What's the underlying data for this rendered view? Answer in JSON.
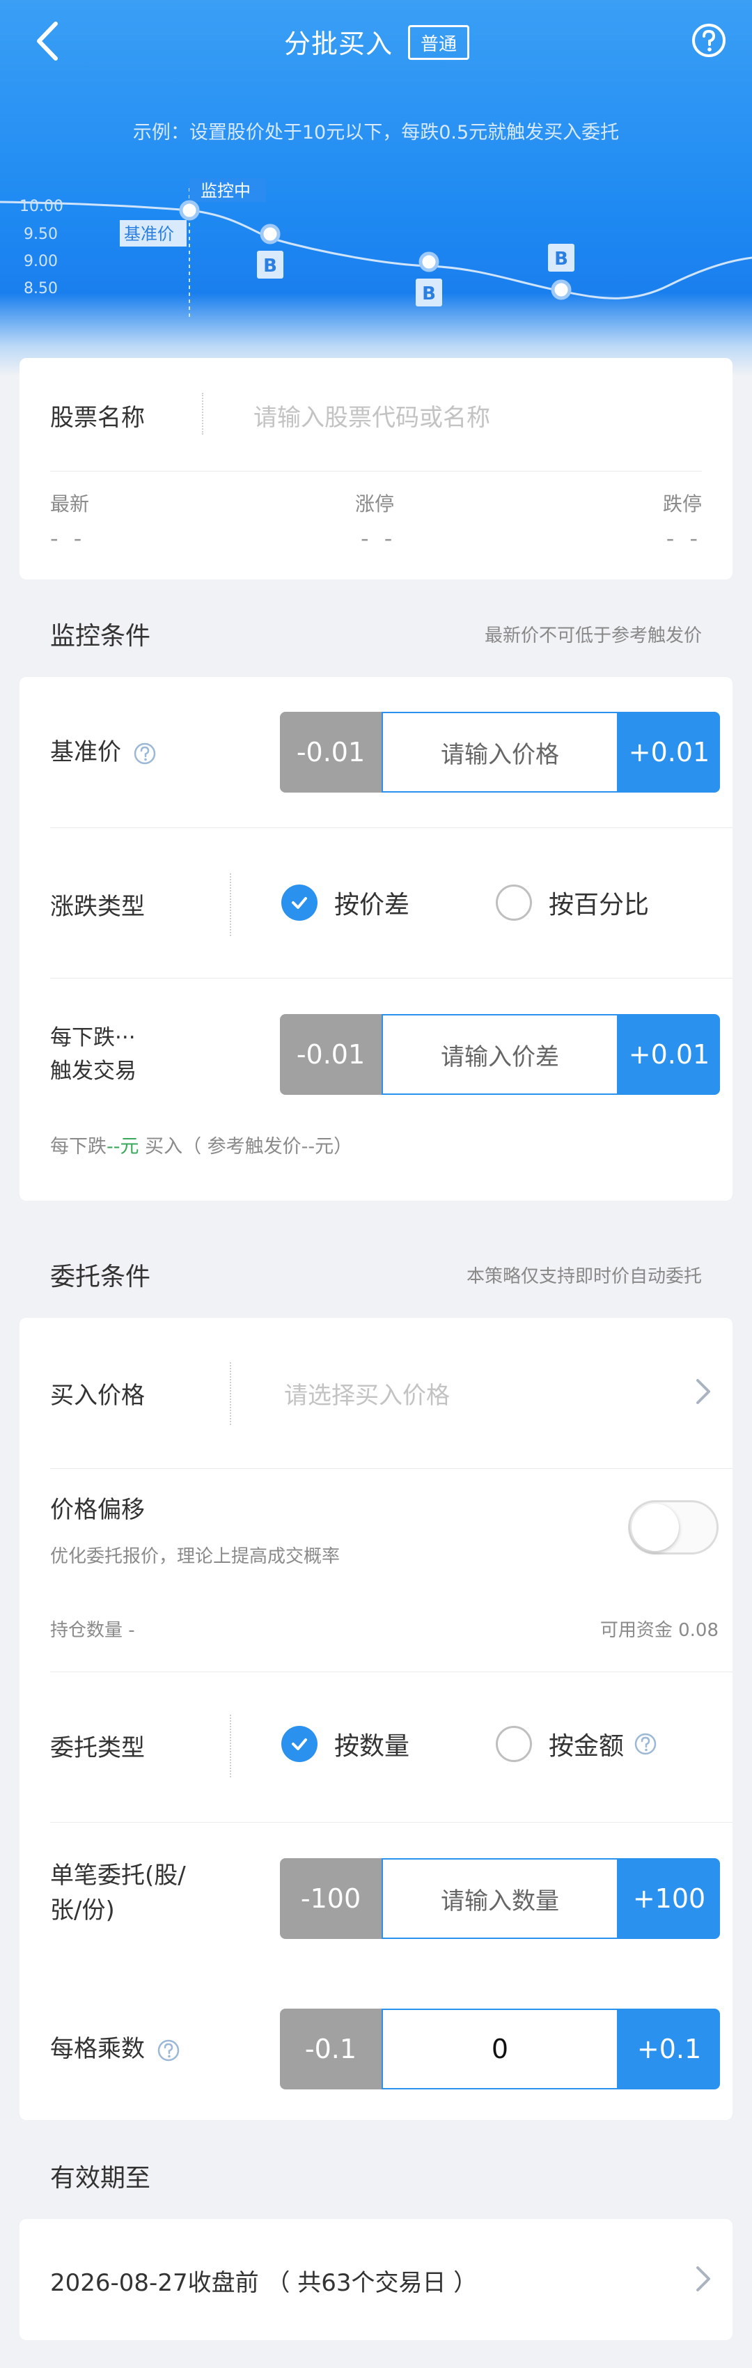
{
  "header": {
    "title": "分批买入",
    "badge": "普通",
    "example": "示例：设置股价处于10元以下，每跌0.5元就触发买入委托"
  },
  "chart_data": {
    "type": "line",
    "y_ticks": [
      "10.00",
      "9.50",
      "9.00",
      "8.50"
    ],
    "monitor_label": "监控中",
    "base_label": "基准价",
    "buy_marker": "B",
    "buy_points": [
      9.5,
      9.0,
      8.5
    ]
  },
  "stock": {
    "label": "股票名称",
    "placeholder": "请输入股票代码或名称",
    "latest_label": "最新",
    "latest_value": "- -",
    "limit_up_label": "涨停",
    "limit_up_value": "- -",
    "limit_down_label": "跌停",
    "limit_down_value": "- -"
  },
  "monitor": {
    "title": "监控条件",
    "note": "最新价不可低于参考触发价",
    "base_price": {
      "label": "基准价",
      "minus": "-0.01",
      "placeholder": "请输入价格",
      "plus": "+0.01"
    },
    "change_type": {
      "label": "涨跌类型",
      "option1": "按价差",
      "option2": "按百分比"
    },
    "drop": {
      "label_line1": "每下跌···",
      "label_line2": "触发交易",
      "minus": "-0.01",
      "placeholder": "请输入价差",
      "plus": "+0.01"
    },
    "hint_prefix": "每下跌",
    "hint_value": "--元",
    "hint_suffix": " 买入（ 参考触发价--元）"
  },
  "order": {
    "title": "委托条件",
    "note": "本策略仅支持即时价自动委托",
    "buy_price": {
      "label": "买入价格",
      "placeholder": "请选择买入价格"
    },
    "offset": {
      "label": "价格偏移",
      "desc": "优化委托报价，理论上提高成交概率"
    },
    "holding": "持仓数量 -",
    "funds": "可用资金 0.08",
    "order_type": {
      "label": "委托类型",
      "option1": "按数量",
      "option2": "按金额"
    },
    "single": {
      "label_line1": "单笔委托(股/",
      "label_line2": "张/份)",
      "minus": "-100",
      "placeholder": "请输入数量",
      "plus": "+100"
    },
    "multiplier": {
      "label": "每格乘数",
      "minus": "-0.1",
      "value": "0",
      "plus": "+0.1"
    }
  },
  "validity": {
    "title": "有效期至",
    "value": "2026-08-27收盘前 （ 共63个交易日 ）"
  },
  "colors": {
    "primary": "#2a92ee",
    "minus_gray": "#a1a1a1",
    "background": "#f1f2f5",
    "hint_green": "#3aa85a"
  }
}
